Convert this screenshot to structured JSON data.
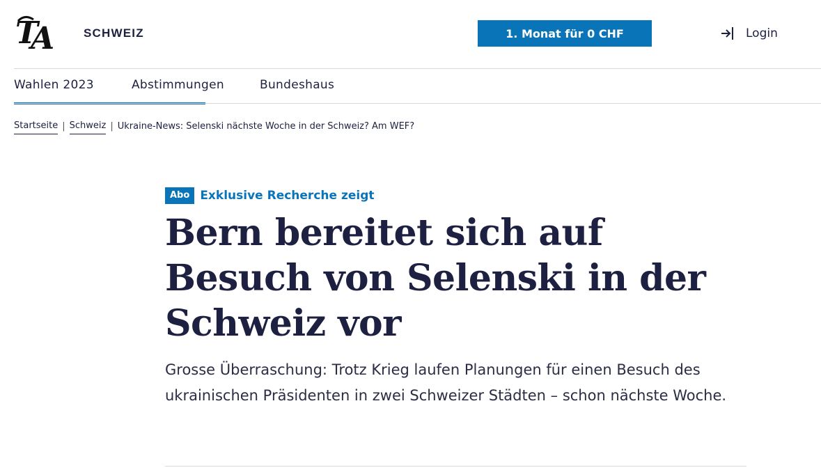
{
  "header": {
    "logo_text": "TA",
    "section": "SCHWEIZ",
    "promo_button": "1. Monat für 0 CHF",
    "login_icon": "login-arrow-icon",
    "login_label": "Login"
  },
  "nav": {
    "items": [
      {
        "label": "Wahlen 2023",
        "active": true
      },
      {
        "label": "Abstimmungen",
        "active": false
      },
      {
        "label": "Bundeshaus",
        "active": false
      }
    ]
  },
  "breadcrumb": {
    "items": [
      "Startseite",
      "Schweiz"
    ],
    "separator": "|",
    "current": "Ukraine-News: Selenski nächste Woche in der Schweiz? Am WEF?"
  },
  "article": {
    "badge": "Abo",
    "kicker": "Exklusive Recherche zeigt",
    "headline": "Bern bereitet sich auf Besuch von Selenski in der Schweiz vor",
    "lead": "Grosse Überraschung: Trotz Krieg laufen Planungen für einen Besuch des ukrainischen Präsidenten in zwei Schweizer Städten – schon nächste Woche."
  },
  "colors": {
    "accent": "#0a74b9",
    "text": "#1d2040",
    "divider": "#d9d9d9"
  }
}
